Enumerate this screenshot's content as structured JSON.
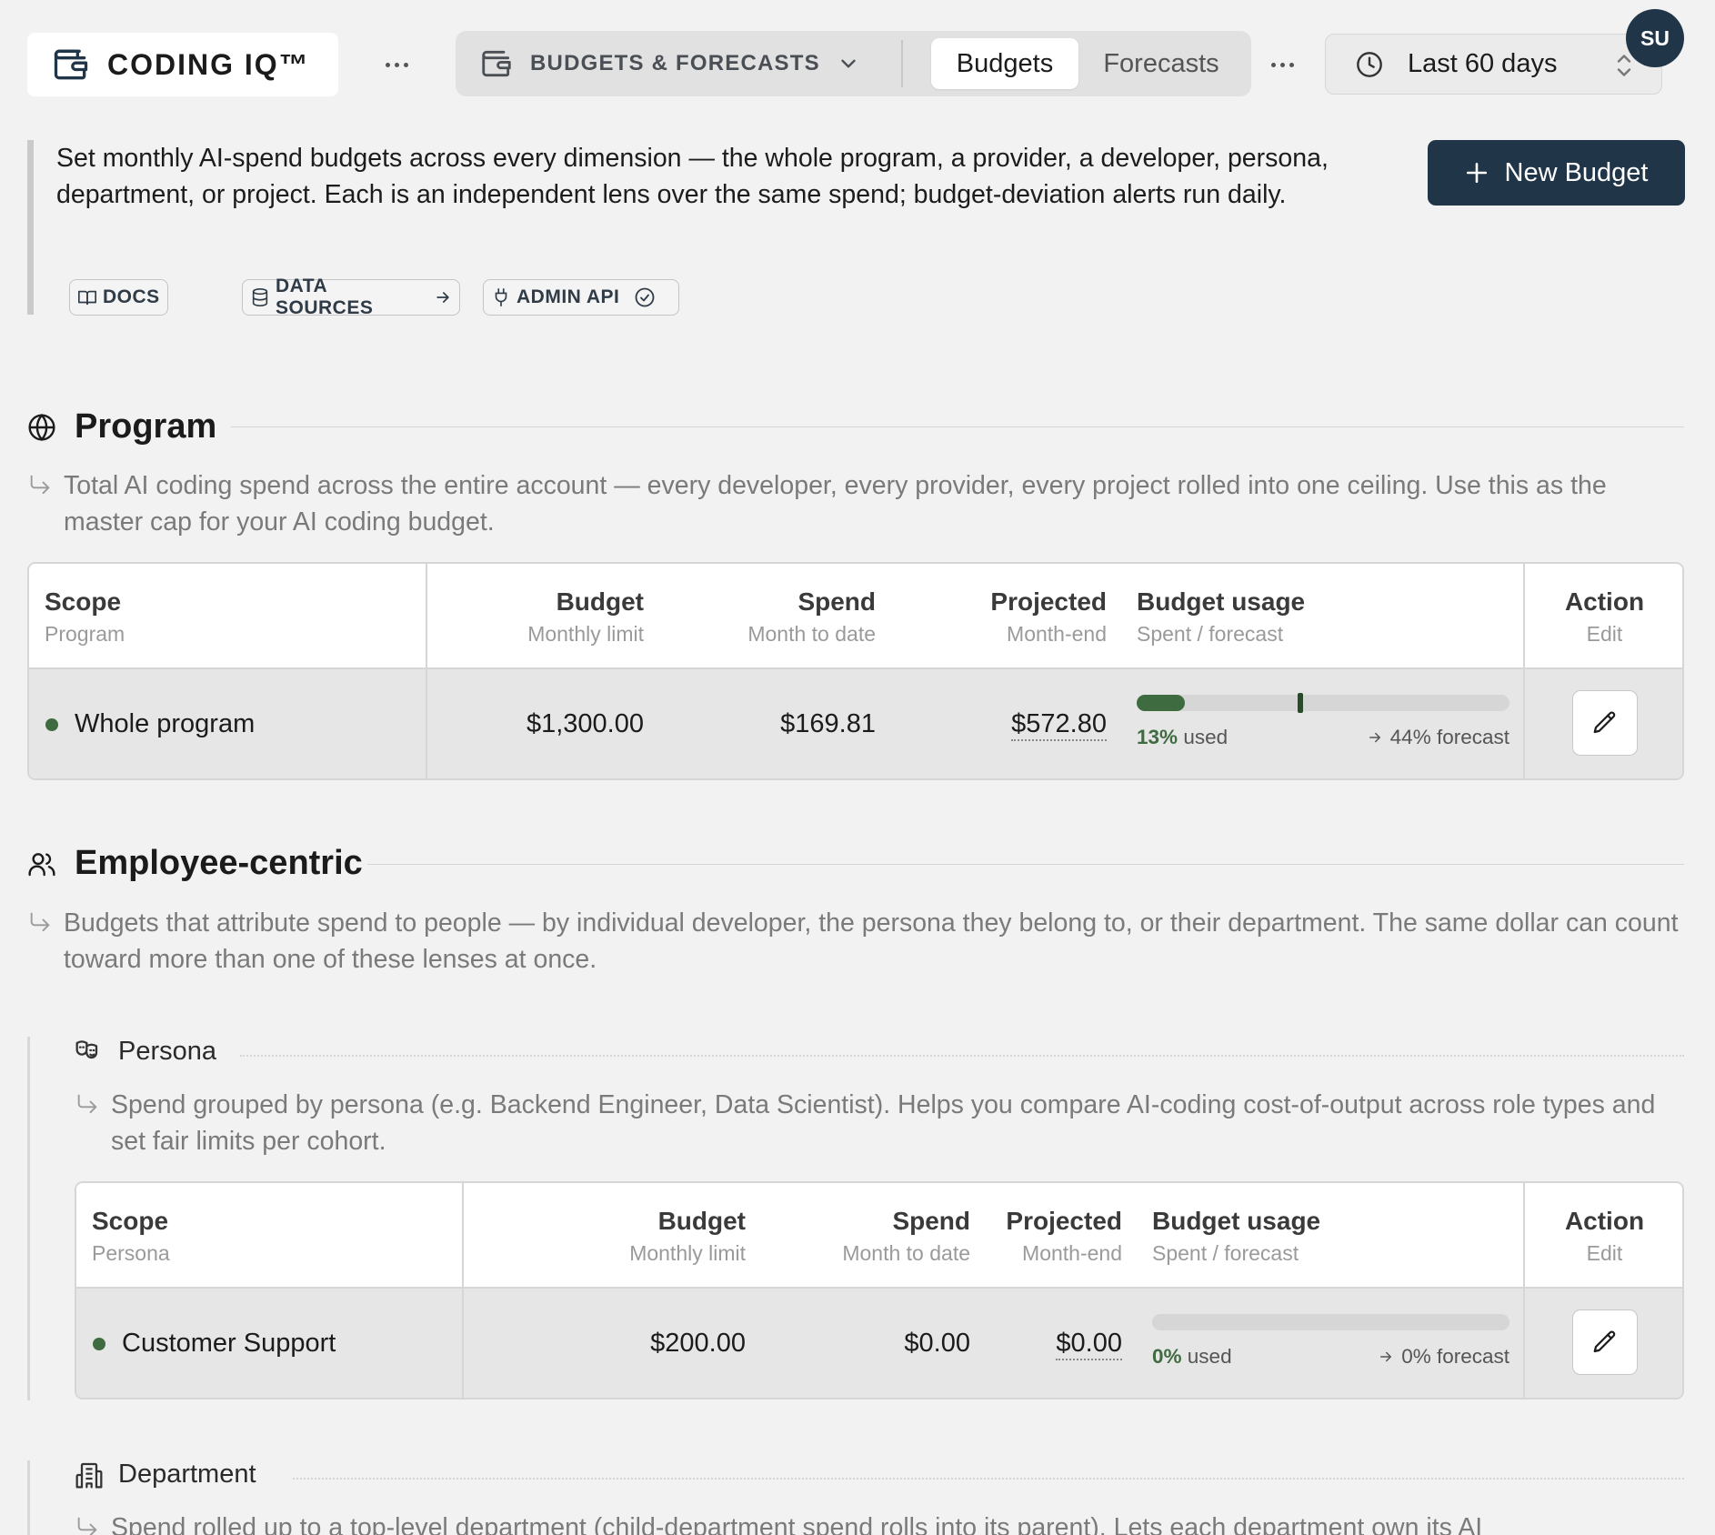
{
  "topbar": {
    "brand": "CODING IQ™",
    "section_selector": "BUDGETS & FORECASTS",
    "tabs": [
      {
        "label": "Budgets",
        "active": true
      },
      {
        "label": "Forecasts",
        "active": false
      }
    ],
    "date_range": "Last 60 days",
    "avatar_initials": "SU"
  },
  "intro": {
    "text": "Set monthly AI-spend budgets across every dimension — the whole program, a provider, a developer, persona, department, or project. Each is an independent lens over the same spend; budget-deviation alerts run daily.",
    "chips": {
      "docs": "DOCS",
      "data_sources": "DATA SOURCES",
      "admin_api": "ADMIN API"
    },
    "new_budget_label": "New Budget"
  },
  "columns": {
    "budget": "Budget",
    "budget_sub": "Monthly limit",
    "spend": "Spend",
    "spend_sub": "Month to date",
    "projected": "Projected",
    "projected_sub": "Month-end",
    "usage": "Budget usage",
    "usage_sub": "Spent / forecast",
    "action": "Action",
    "action_sub": "Edit",
    "scope": "Scope"
  },
  "program": {
    "title": "Program",
    "description": "Total AI coding spend across the entire account — every developer, every provider, every project rolled into one ceiling. Use this as the master cap for your AI coding budget.",
    "scope_sub": "Program",
    "row": {
      "name": "Whole program",
      "budget": "$1,300.00",
      "spend": "$169.81",
      "projected": "$572.80",
      "used_pct": "13%",
      "used_word": "used",
      "forecast_text": "44% forecast",
      "used_fraction": 0.13,
      "forecast_fraction": 0.44
    }
  },
  "employee": {
    "title": "Employee-centric",
    "description": "Budgets that attribute spend to people — by individual developer, the persona they belong to, or their department. The same dollar can count toward more than one of these lenses at once."
  },
  "persona": {
    "title": "Persona",
    "description": "Spend grouped by persona (e.g. Backend Engineer, Data Scientist). Helps you compare AI-coding cost-of-output across role types and set fair limits per cohort.",
    "scope_sub": "Persona",
    "row": {
      "name": "Customer Support",
      "budget": "$200.00",
      "spend": "$0.00",
      "projected": "$0.00",
      "used_pct": "0%",
      "used_word": "used",
      "forecast_text": "0% forecast",
      "used_fraction": 0,
      "forecast_fraction": 0
    }
  },
  "department": {
    "title": "Department",
    "description": "Spend rolled up to a top-level department (child-department spend rolls into its parent). Lets each department own its AI"
  },
  "colors": {
    "accent_dark": "#203547",
    "status_green": "#3f6b40"
  }
}
